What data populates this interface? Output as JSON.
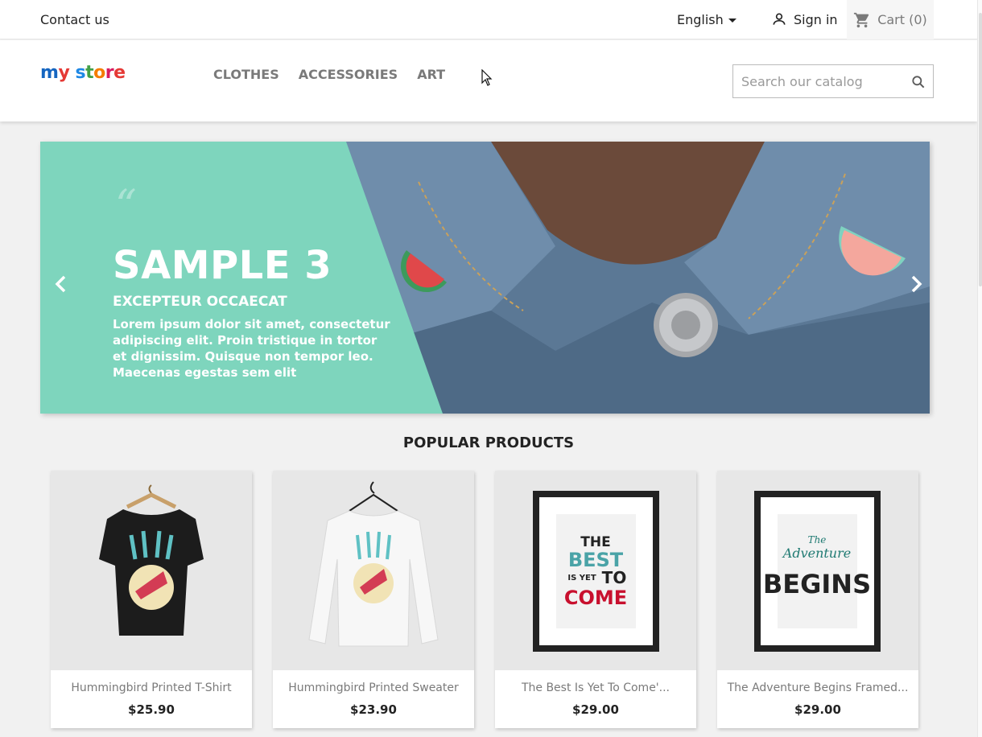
{
  "topbar": {
    "contact": "Contact us",
    "language": "English",
    "signin": "Sign in",
    "cart": "Cart (0)"
  },
  "header": {
    "logo_text": "my store",
    "nav": [
      {
        "label": "CLOTHES"
      },
      {
        "label": "ACCESSORIES"
      },
      {
        "label": "ART"
      }
    ],
    "search_placeholder": "Search our catalog"
  },
  "slider": {
    "title": "SAMPLE 3",
    "subtitle": "EXCEPTEUR OCCAECAT",
    "text": "Lorem ipsum dolor sit amet, consectetur adipiscing elit. Proin tristique in tortor et dignissim. Quisque non tempor leo. Maecenas egestas sem elit",
    "accent": "#7ed5bd"
  },
  "section_title": "POPULAR PRODUCTS",
  "products": [
    {
      "name": "Hummingbird Printed T-Shirt",
      "price": "$25.90"
    },
    {
      "name": "Hummingbird Printed Sweater",
      "price": "$23.90"
    },
    {
      "name": "The Best Is Yet To Come'...",
      "price": "$29.00"
    },
    {
      "name": "The Adventure Begins Framed...",
      "price": "$29.00"
    }
  ],
  "art": {
    "poster1": [
      "THE",
      "BEST",
      "IS YET",
      "TO",
      "COME"
    ],
    "poster2": [
      "The",
      "Adventure",
      "BEGINS"
    ]
  },
  "colors": {
    "primary_text": "#232323",
    "muted_text": "#7a7a7a",
    "background": "#f1f1f1",
    "poster_teal": "#4aa3a7",
    "poster_red": "#c8102e"
  },
  "icons": {
    "language_caret": "caret-down-icon",
    "signin": "user-icon",
    "cart": "shopping-cart-icon",
    "search": "search-icon",
    "slider_prev": "chevron-left-icon",
    "slider_next": "chevron-right-icon"
  }
}
